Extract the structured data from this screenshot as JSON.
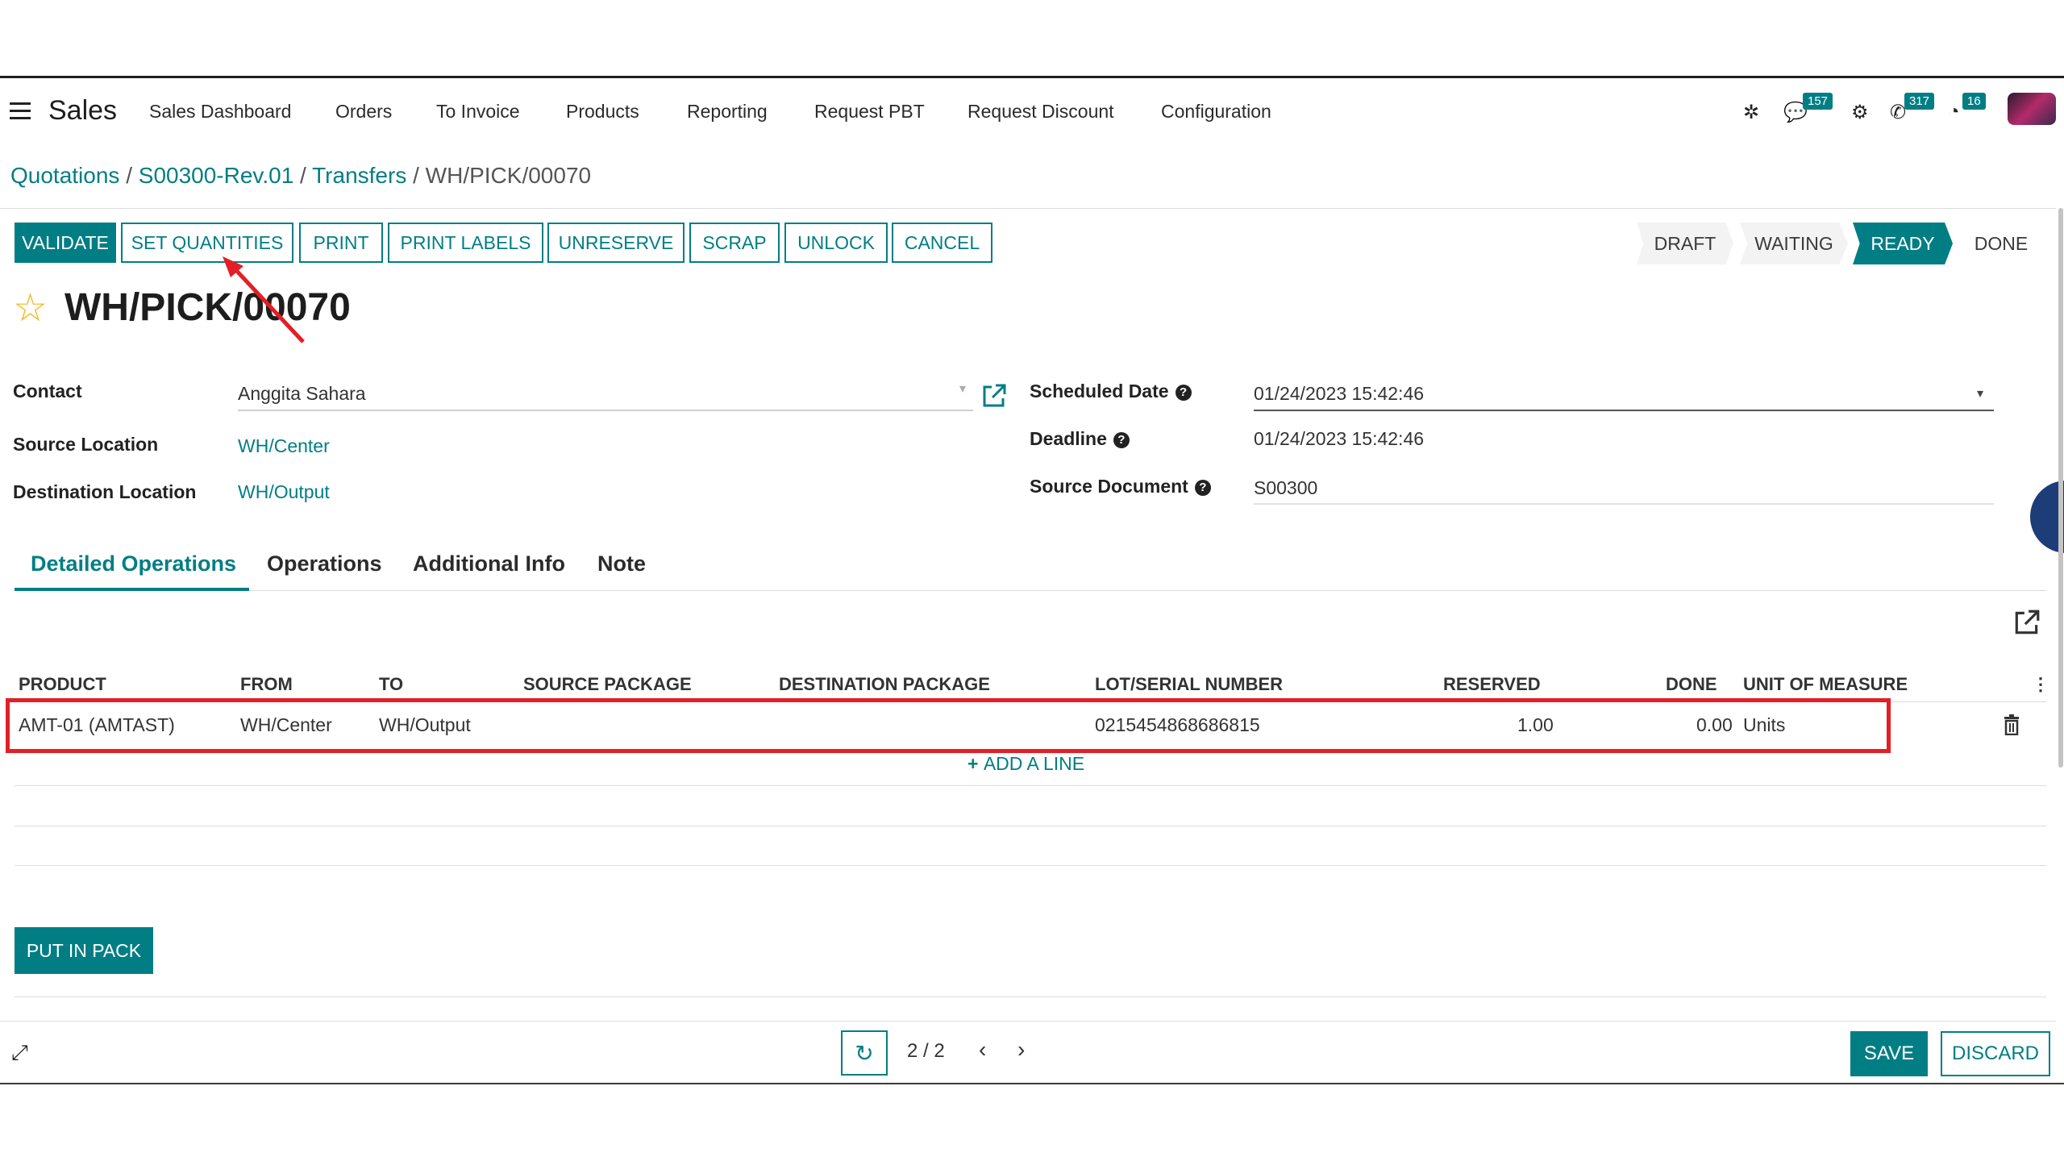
{
  "navbar": {
    "app_name": "Sales",
    "menu": [
      "Sales Dashboard",
      "Orders",
      "To Invoice",
      "Products",
      "Reporting",
      "Request PBT",
      "Request Discount",
      "Configuration"
    ],
    "badges": {
      "messages": "157",
      "activities": "317",
      "calls": "16"
    }
  },
  "breadcrumb": {
    "quotations": "Quotations",
    "order": "S00300-Rev.01",
    "transfers": "Transfers",
    "current": "WH/PICK/00070",
    "separator": "/"
  },
  "actions": {
    "validate": "VALIDATE",
    "set_quantities": "SET QUANTITIES",
    "print": "PRINT",
    "print_labels": "PRINT LABELS",
    "unreserve": "UNRESERVE",
    "scrap": "SCRAP",
    "unlock": "UNLOCK",
    "cancel": "CANCEL"
  },
  "statusbar": {
    "draft": "DRAFT",
    "waiting": "WAITING",
    "ready": "READY",
    "done": "DONE"
  },
  "record": {
    "title": "WH/PICK/00070",
    "contact_label": "Contact",
    "contact": "Anggita Sahara",
    "source_location_label": "Source Location",
    "source_location": "WH/Center",
    "destination_location_label": "Destination Location",
    "destination_location": "WH/Output",
    "scheduled_date_label": "Scheduled Date",
    "scheduled_date": "01/24/2023 15:42:46",
    "deadline_label": "Deadline",
    "deadline": "01/24/2023 15:42:46",
    "source_document_label": "Source Document",
    "source_document": "S00300"
  },
  "tabs": [
    "Detailed Operations",
    "Operations",
    "Additional Info",
    "Note"
  ],
  "table": {
    "headers": {
      "product": "PRODUCT",
      "from": "FROM",
      "to": "TO",
      "source_package": "SOURCE PACKAGE",
      "destination_package": "DESTINATION PACKAGE",
      "lot": "LOT/SERIAL NUMBER",
      "reserved": "RESERVED",
      "done": "DONE",
      "uom": "UNIT OF MEASURE"
    },
    "rows": [
      {
        "product": "AMT-01 (AMTAST)",
        "from": "WH/Center",
        "to": "WH/Output",
        "source_package": "",
        "destination_package": "",
        "lot": "0215454868686815",
        "reserved": "1.00",
        "done": "0.00",
        "uom": "Units"
      }
    ],
    "add_line": "ADD A LINE"
  },
  "put_in_pack": "PUT IN PACK",
  "pager": {
    "value": "2 / 2"
  },
  "footer": {
    "save": "SAVE",
    "discard": "DISCARD"
  },
  "colors": {
    "accent": "#017e84",
    "highlight": "#e41e26",
    "star": "#f2b822"
  }
}
